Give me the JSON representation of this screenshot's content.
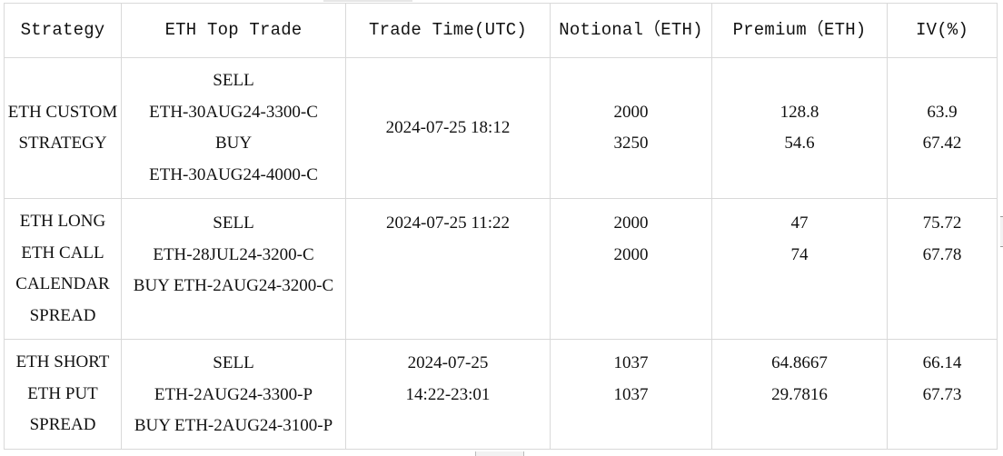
{
  "table": {
    "headers": [
      "Strategy",
      "ETH Top Trade",
      "Trade Time(UTC)",
      "Notional（ETH)",
      "Premium（ETH)",
      "IV(%)"
    ],
    "rows": [
      {
        "strategy": [
          "ETH CUSTOM",
          "STRATEGY"
        ],
        "top_trade": [
          "SELL",
          "ETH-30AUG24-3300-C",
          "BUY",
          "ETH-30AUG24-4000-C"
        ],
        "trade_time": [
          "2024-07-25 18:12"
        ],
        "notional": [
          "2000",
          "3250"
        ],
        "premium": [
          "128.8",
          "54.6"
        ],
        "iv": [
          "63.9",
          "67.42"
        ]
      },
      {
        "strategy": [
          "ETH LONG",
          "ETH CALL",
          "CALENDAR",
          "SPREAD"
        ],
        "top_trade": [
          "SELL",
          "ETH-28JUL24-3200-C",
          "BUY ETH-2AUG24-3200-C"
        ],
        "trade_time": [
          "2024-07-25 11:22"
        ],
        "notional": [
          "2000",
          "2000"
        ],
        "premium": [
          "47",
          "74"
        ],
        "iv": [
          "75.72",
          "67.78"
        ]
      },
      {
        "strategy": [
          "ETH SHORT",
          "ETH PUT",
          "SPREAD"
        ],
        "top_trade": [
          "SELL",
          "ETH-2AUG24-3300-P",
          "BUY ETH-2AUG24-3100-P"
        ],
        "trade_time": [
          "2024-07-25",
          "14:22-23:01"
        ],
        "notional": [
          "1037",
          "1037"
        ],
        "premium": [
          "64.8667",
          "29.7816"
        ],
        "iv": [
          "66.14",
          "67.73"
        ]
      }
    ]
  },
  "colors": {
    "grid": "#d9d9d9",
    "text": "#111111",
    "background": "#ffffff"
  }
}
